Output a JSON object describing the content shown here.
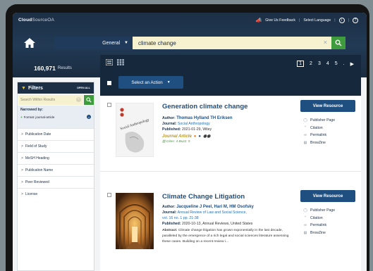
{
  "header": {
    "logo_bold": "Cloud",
    "logo_light": "SourceOA",
    "feedback": "Give Us Feedback",
    "divider": "|",
    "language": "Select Language",
    "info": "i",
    "help": "?"
  },
  "search": {
    "scope": "General",
    "query": "climate change",
    "clear": "×"
  },
  "results_count": {
    "number": "160,971",
    "label": "Results"
  },
  "toolbar": {
    "action": "Select an Action",
    "pages": [
      "1",
      "2",
      "3",
      "4",
      "5",
      "."
    ],
    "next": "▶"
  },
  "filters": {
    "title": "Filters",
    "open_all": "OPEN ALL",
    "search_placeholder": "Search Within Results",
    "search_clear": "×",
    "narrowed_label": "Narrowed by:",
    "chip": "Format: journal-article",
    "chip_plus": "+",
    "chip_remove": "×",
    "facets": [
      "Publication Date",
      "Field of Study",
      "MeSH Heading",
      "Publication Name",
      "Peer Reviewed",
      "License"
    ]
  },
  "results": [
    {
      "title": "Generation climate change",
      "author_label": "Author:",
      "author": "Thomas Hylland TH Eriksen",
      "journal_label": "Journal:",
      "journal": "Social Anthropology",
      "published_label": "Published:",
      "published": "2021-01-29, Wiley",
      "format": "Journal Article",
      "cites": "Cites: 4  Buzz: 5",
      "thumb_text": "Social Anthropology",
      "actions": [
        "Publisher Page",
        "Citation",
        "Permalink",
        "BrowZine"
      ]
    },
    {
      "title": "Climate Change Litigation",
      "author_label": "Author:",
      "author": "Jacqueline J Peel, Hari M, HM Osofsky",
      "journal_label": "Journal:",
      "journal": "Annual Review of Law and Social Science,",
      "volume": "vol. 16 no. 1 pp. 21-38",
      "published_label": "Published:",
      "published": "2020-10-13, Annual Reviews, United States",
      "abstract_label": "Abstract:",
      "abstract": "Climate change litigation has grown exponentially in the last decade, paralleled by the emergence of a rich legal and social sciences literature assessing these cases. Building on a recent review i...",
      "actions": [
        "Publisher Page",
        "Citation",
        "Permalink",
        "BrowZine"
      ]
    }
  ],
  "view_resource": "View Resource",
  "colors": {
    "navy": "#1c2f45",
    "accent_blue": "#1f4e80",
    "green": "#3f9c3c",
    "search_bg": "#f6f1cf",
    "gold": "#b7972d"
  }
}
